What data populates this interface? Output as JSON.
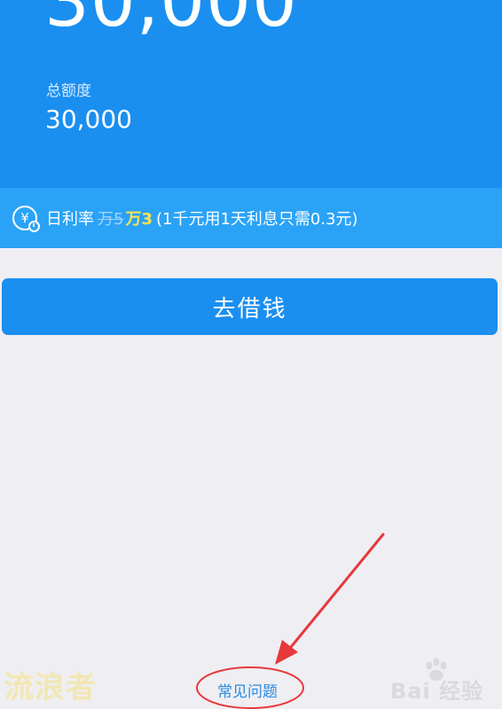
{
  "header": {
    "available_amount": "30,000",
    "total_label": "总额度",
    "total_amount": "30,000"
  },
  "rate": {
    "icon_glyph": "¥",
    "label": "日利率",
    "old_rate": "万5",
    "new_rate": "万3",
    "note": "(1千元用1天利息只需0.3元)"
  },
  "actions": {
    "borrow_label": "去借钱",
    "faq_label": "常见问题"
  },
  "watermarks": {
    "left": "流浪者",
    "right": "Bai 经验"
  },
  "colors": {
    "primary_blue": "#1a8ff0",
    "rate_bar_blue": "#2aa3f7",
    "highlight_yellow": "#ffe34d",
    "annotation_red": "#e8383b",
    "background": "#efeef3"
  }
}
